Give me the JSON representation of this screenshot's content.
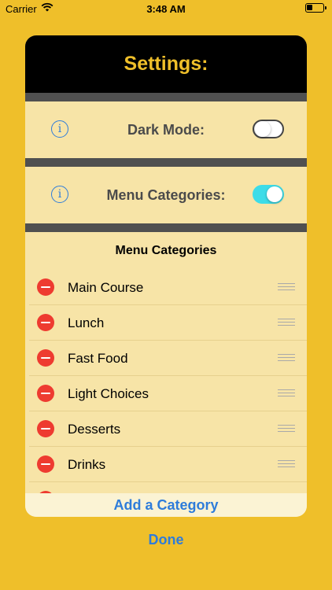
{
  "status_bar": {
    "carrier": "Carrier",
    "time": "3:48 AM"
  },
  "card": {
    "title": "Settings:",
    "settings": [
      {
        "label": "Dark Mode:",
        "toggle_on": false
      },
      {
        "label": "Menu Categories:",
        "toggle_on": true
      }
    ],
    "list_title": "Menu Categories",
    "categories": [
      {
        "label": "Main Course"
      },
      {
        "label": "Lunch"
      },
      {
        "label": "Fast Food"
      },
      {
        "label": "Light Choices"
      },
      {
        "label": "Desserts"
      },
      {
        "label": "Drinks"
      }
    ],
    "add_label": "Add a Category"
  },
  "done_label": "Done",
  "colors": {
    "background": "#EFBF2A",
    "card": "#F7E4A7",
    "accent_blue": "#2E7CDA",
    "toggle_on": "#3DDCE8",
    "delete_red": "#EE3B30"
  }
}
